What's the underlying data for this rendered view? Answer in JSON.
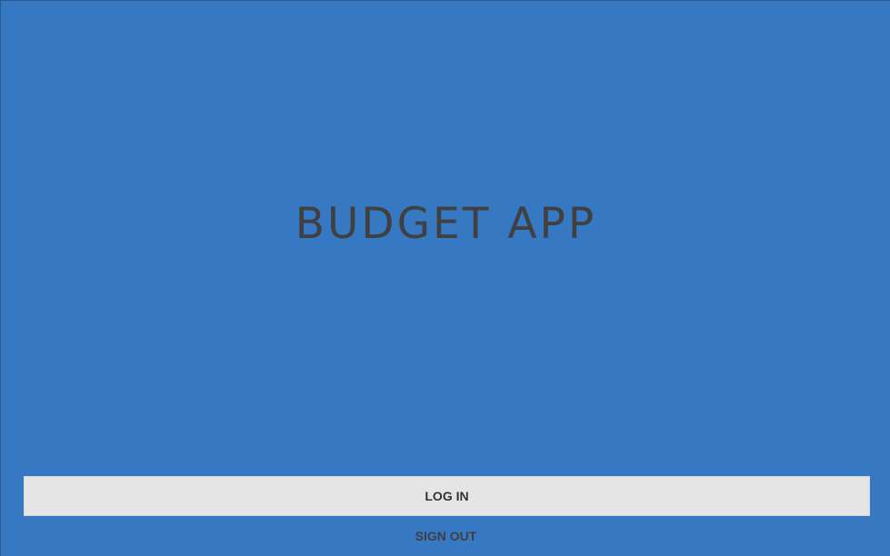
{
  "app": {
    "title": "BUDGET APP"
  },
  "actions": {
    "login_label": "LOG IN",
    "signout_label": "SIGN OUT"
  },
  "colors": {
    "background": "#3778c2",
    "title_text": "#404040",
    "button_bg": "#e5e5e5",
    "button_text": "#333333"
  }
}
